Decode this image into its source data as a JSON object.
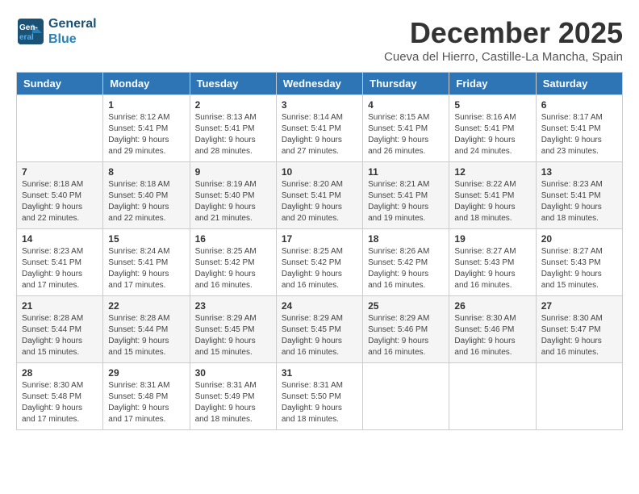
{
  "logo": {
    "line1": "General",
    "line2": "Blue"
  },
  "title": "December 2025",
  "subtitle": "Cueva del Hierro, Castille-La Mancha, Spain",
  "headers": [
    "Sunday",
    "Monday",
    "Tuesday",
    "Wednesday",
    "Thursday",
    "Friday",
    "Saturday"
  ],
  "weeks": [
    [
      {
        "day": "",
        "info": ""
      },
      {
        "day": "1",
        "info": "Sunrise: 8:12 AM\nSunset: 5:41 PM\nDaylight: 9 hours\nand 29 minutes."
      },
      {
        "day": "2",
        "info": "Sunrise: 8:13 AM\nSunset: 5:41 PM\nDaylight: 9 hours\nand 28 minutes."
      },
      {
        "day": "3",
        "info": "Sunrise: 8:14 AM\nSunset: 5:41 PM\nDaylight: 9 hours\nand 27 minutes."
      },
      {
        "day": "4",
        "info": "Sunrise: 8:15 AM\nSunset: 5:41 PM\nDaylight: 9 hours\nand 26 minutes."
      },
      {
        "day": "5",
        "info": "Sunrise: 8:16 AM\nSunset: 5:41 PM\nDaylight: 9 hours\nand 24 minutes."
      },
      {
        "day": "6",
        "info": "Sunrise: 8:17 AM\nSunset: 5:41 PM\nDaylight: 9 hours\nand 23 minutes."
      }
    ],
    [
      {
        "day": "7",
        "info": "Sunrise: 8:18 AM\nSunset: 5:40 PM\nDaylight: 9 hours\nand 22 minutes."
      },
      {
        "day": "8",
        "info": "Sunrise: 8:18 AM\nSunset: 5:40 PM\nDaylight: 9 hours\nand 22 minutes."
      },
      {
        "day": "9",
        "info": "Sunrise: 8:19 AM\nSunset: 5:40 PM\nDaylight: 9 hours\nand 21 minutes."
      },
      {
        "day": "10",
        "info": "Sunrise: 8:20 AM\nSunset: 5:41 PM\nDaylight: 9 hours\nand 20 minutes."
      },
      {
        "day": "11",
        "info": "Sunrise: 8:21 AM\nSunset: 5:41 PM\nDaylight: 9 hours\nand 19 minutes."
      },
      {
        "day": "12",
        "info": "Sunrise: 8:22 AM\nSunset: 5:41 PM\nDaylight: 9 hours\nand 18 minutes."
      },
      {
        "day": "13",
        "info": "Sunrise: 8:23 AM\nSunset: 5:41 PM\nDaylight: 9 hours\nand 18 minutes."
      }
    ],
    [
      {
        "day": "14",
        "info": "Sunrise: 8:23 AM\nSunset: 5:41 PM\nDaylight: 9 hours\nand 17 minutes."
      },
      {
        "day": "15",
        "info": "Sunrise: 8:24 AM\nSunset: 5:41 PM\nDaylight: 9 hours\nand 17 minutes."
      },
      {
        "day": "16",
        "info": "Sunrise: 8:25 AM\nSunset: 5:42 PM\nDaylight: 9 hours\nand 16 minutes."
      },
      {
        "day": "17",
        "info": "Sunrise: 8:25 AM\nSunset: 5:42 PM\nDaylight: 9 hours\nand 16 minutes."
      },
      {
        "day": "18",
        "info": "Sunrise: 8:26 AM\nSunset: 5:42 PM\nDaylight: 9 hours\nand 16 minutes."
      },
      {
        "day": "19",
        "info": "Sunrise: 8:27 AM\nSunset: 5:43 PM\nDaylight: 9 hours\nand 16 minutes."
      },
      {
        "day": "20",
        "info": "Sunrise: 8:27 AM\nSunset: 5:43 PM\nDaylight: 9 hours\nand 15 minutes."
      }
    ],
    [
      {
        "day": "21",
        "info": "Sunrise: 8:28 AM\nSunset: 5:44 PM\nDaylight: 9 hours\nand 15 minutes."
      },
      {
        "day": "22",
        "info": "Sunrise: 8:28 AM\nSunset: 5:44 PM\nDaylight: 9 hours\nand 15 minutes."
      },
      {
        "day": "23",
        "info": "Sunrise: 8:29 AM\nSunset: 5:45 PM\nDaylight: 9 hours\nand 15 minutes."
      },
      {
        "day": "24",
        "info": "Sunrise: 8:29 AM\nSunset: 5:45 PM\nDaylight: 9 hours\nand 16 minutes."
      },
      {
        "day": "25",
        "info": "Sunrise: 8:29 AM\nSunset: 5:46 PM\nDaylight: 9 hours\nand 16 minutes."
      },
      {
        "day": "26",
        "info": "Sunrise: 8:30 AM\nSunset: 5:46 PM\nDaylight: 9 hours\nand 16 minutes."
      },
      {
        "day": "27",
        "info": "Sunrise: 8:30 AM\nSunset: 5:47 PM\nDaylight: 9 hours\nand 16 minutes."
      }
    ],
    [
      {
        "day": "28",
        "info": "Sunrise: 8:30 AM\nSunset: 5:48 PM\nDaylight: 9 hours\nand 17 minutes."
      },
      {
        "day": "29",
        "info": "Sunrise: 8:31 AM\nSunset: 5:48 PM\nDaylight: 9 hours\nand 17 minutes."
      },
      {
        "day": "30",
        "info": "Sunrise: 8:31 AM\nSunset: 5:49 PM\nDaylight: 9 hours\nand 18 minutes."
      },
      {
        "day": "31",
        "info": "Sunrise: 8:31 AM\nSunset: 5:50 PM\nDaylight: 9 hours\nand 18 minutes."
      },
      {
        "day": "",
        "info": ""
      },
      {
        "day": "",
        "info": ""
      },
      {
        "day": "",
        "info": ""
      }
    ]
  ]
}
